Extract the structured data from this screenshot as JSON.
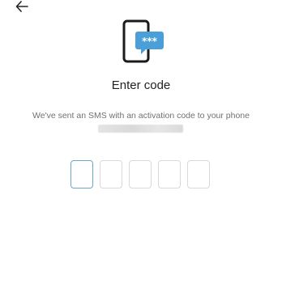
{
  "screen": {
    "title": "Enter code",
    "subtitle": "We've sent an SMS with an activation code to your phone",
    "phone_number": ""
  },
  "code_input": {
    "length": 5,
    "values": [
      "",
      "",
      "",
      "",
      ""
    ],
    "active_index": 0
  },
  "icons": {
    "back": "arrow-left-icon",
    "hero": "phone-sms-icon"
  },
  "colors": {
    "accent": "#4a9fd8",
    "active_border": "#6aa8c9",
    "cell_border": "#d9d9d9",
    "text_primary": "#222222",
    "text_secondary": "#707070"
  }
}
